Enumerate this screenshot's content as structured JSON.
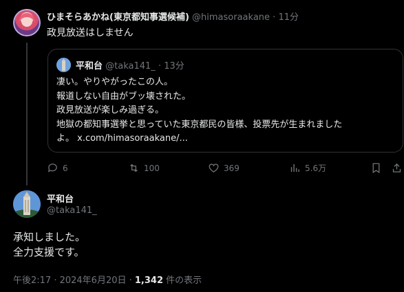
{
  "tweet": {
    "display_name": "ひまそらあかね(東京都知事選候補)",
    "handle": "@himasoraakane",
    "separator": "·",
    "time": "11分",
    "text": "政見放送はしません",
    "quote": {
      "display_name": "平和台",
      "handle": "@taka141_",
      "separator": "·",
      "time": "13分",
      "lines": [
        "凄い。やりやがったこの人。",
        "報道しない自由がブッ壊された。",
        "政見放送が楽しみ過ぎる。",
        "地獄の都知事選挙と思っていた東京都民の皆様、投票先が生まれました",
        "よ。 x.com/himasoraakane/..."
      ]
    },
    "actions": {
      "replies": "6",
      "reposts": "100",
      "likes": "369",
      "views": "5.6万"
    }
  },
  "reply": {
    "display_name": "平和台",
    "handle": "@taka141_",
    "lines": [
      "承知しました。",
      "全力支援です。"
    ],
    "timestamp": "午後2:17 · 2024年6月20日 · ",
    "view_count": "1,342",
    "view_suffix": " 件の表示"
  },
  "colors": {
    "background": "#000000",
    "text": "#e7e9ea",
    "muted": "#71767b",
    "border": "#2f3336"
  }
}
